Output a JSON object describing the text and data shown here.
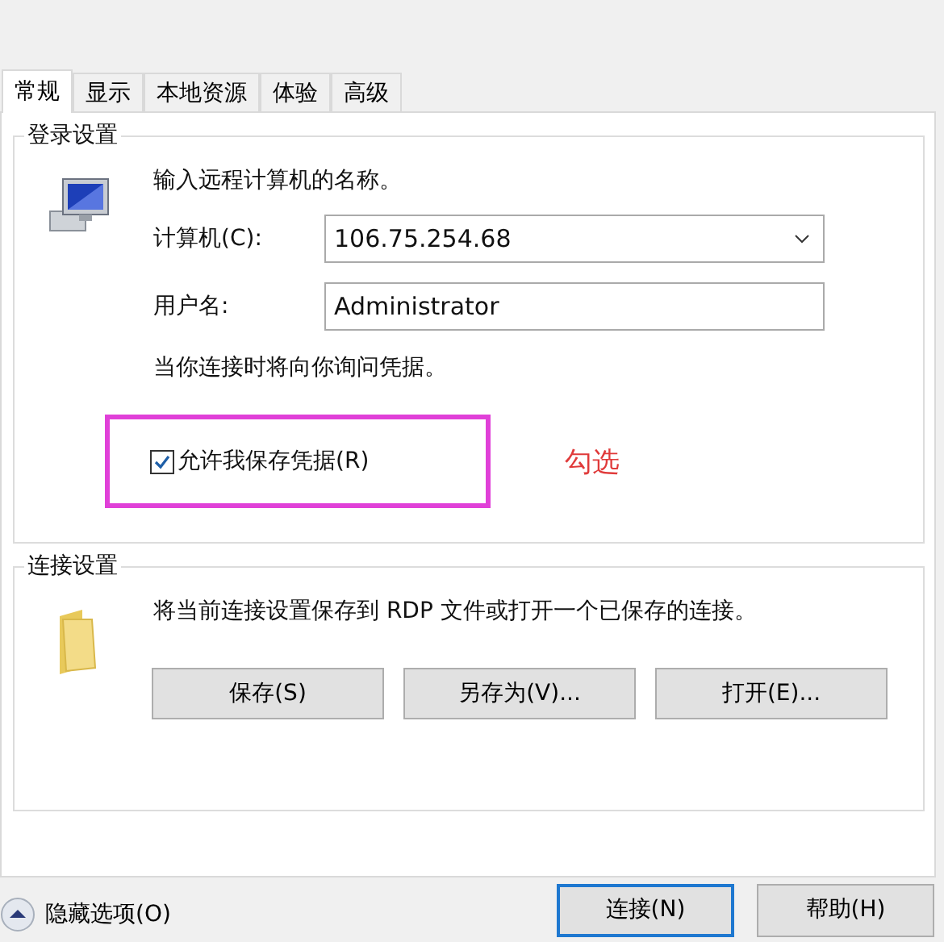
{
  "tabs": [
    {
      "label": "常规",
      "selected": true
    },
    {
      "label": "显示",
      "selected": false
    },
    {
      "label": "本地资源",
      "selected": false
    },
    {
      "label": "体验",
      "selected": false
    },
    {
      "label": "高级",
      "selected": false
    }
  ],
  "logon": {
    "title": "登录设置",
    "intro": "输入远程计算机的名称。",
    "computer_label": "计算机(C):",
    "computer_value": "106.75.254.68",
    "user_label": "用户名:",
    "user_value": "Administrator",
    "note": "当你连接时将向你询问凭据。",
    "save_credentials": {
      "label": "允许我保存凭据(R)",
      "checked": true
    },
    "annotation": "勾选"
  },
  "connection": {
    "title": "连接设置",
    "text": "将当前连接设置保存到 RDP 文件或打开一个已保存的连接。",
    "buttons": [
      "保存(S)",
      "另存为(V)...",
      "打开(E)..."
    ]
  },
  "footer": {
    "toggle": "隐藏选项(O)",
    "buttons": [
      {
        "label": "连接(N)",
        "default": true
      },
      {
        "label": "帮助(H)",
        "default": false
      }
    ]
  }
}
